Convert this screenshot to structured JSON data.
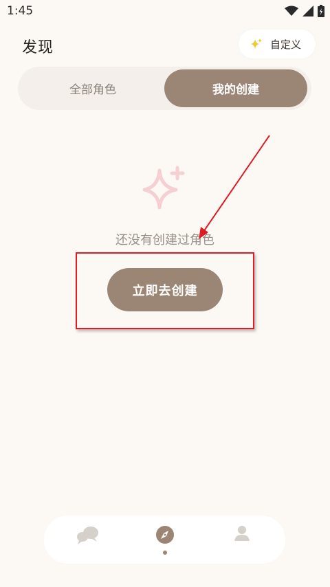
{
  "status_bar": {
    "time": "1:45",
    "icons": [
      "wifi-icon",
      "cellular-signal-icon",
      "battery-icon"
    ]
  },
  "header": {
    "title": "发现",
    "customize_label": "自定义",
    "customize_icon": "sparkle-icon"
  },
  "tabs": [
    {
      "label": "全部角色",
      "selected": false
    },
    {
      "label": "我的创建",
      "selected": true
    }
  ],
  "empty_state": {
    "icon": "sparkle-outline-icon",
    "message": "还没有创建过角色",
    "action_label": "立即去创建"
  },
  "bottom_nav": {
    "items": [
      {
        "name": "chat",
        "icon": "chat-bubbles-icon",
        "active": false
      },
      {
        "name": "discover",
        "icon": "compass-icon",
        "active": true
      },
      {
        "name": "profile",
        "icon": "person-icon",
        "active": false
      }
    ]
  },
  "colors": {
    "background": "#fcf9f4",
    "accent": "#9b8574",
    "annotation": "#e01b24",
    "sparkle_pink": "#f6cfd3",
    "sparkle_yellow": "#f0c832"
  }
}
